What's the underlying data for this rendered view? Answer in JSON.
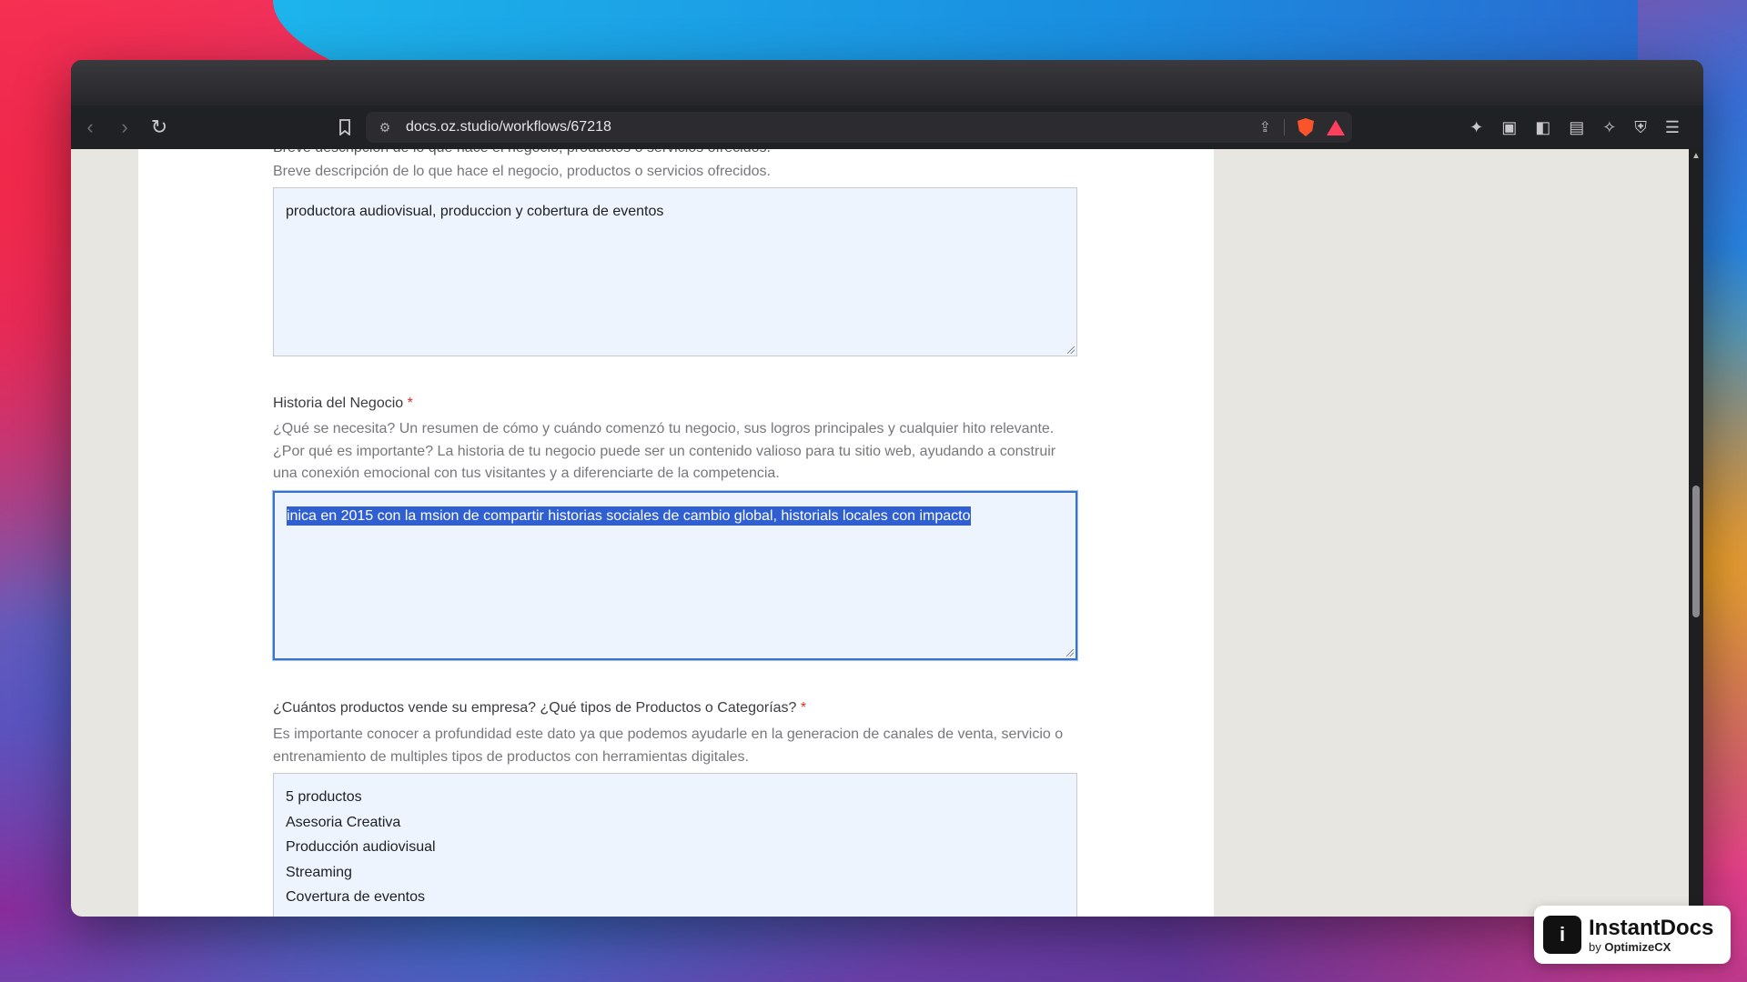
{
  "browser": {
    "url": "docs.oz.studio/workflows/67218"
  },
  "form": {
    "cut_off_label": "Breve descripción de lo que hace el negocio, productos o servicios ofrecidos.",
    "business_description": {
      "help": "Breve descripción de lo que hace el negocio, productos o servicios ofrecidos.",
      "value": "productora audiovisual, produccion y cobertura de eventos"
    },
    "business_history": {
      "label": "Historia del Negocio",
      "required_mark": "*",
      "help": "¿Qué se necesita? Un resumen de cómo y cuándo comenzó tu negocio, sus logros principales y cualquier hito relevante. ¿Por qué es importante? La historia de tu negocio puede ser un contenido valioso para tu sitio web, ayudando a construir una conexión emocional con tus visitantes y a diferenciarte de la competencia.",
      "value": "inica en 2015 con la msion de compartir historias sociales de cambio global, historials locales con impacto"
    },
    "products": {
      "label": "¿Cuántos productos vende su empresa? ¿Qué tipos de Productos o Categorías?",
      "required_mark": "*",
      "help": "Es importante conocer a profundidad este dato ya que podemos ayudarle en la generacion de canales de venta, servicio o entrenamiento de multiples tipos de productos con herramientas digitales.",
      "lines": [
        "5 productos",
        "Asesoria Creativa",
        "Producción audiovisual",
        "Streaming",
        "Covertura de eventos"
      ]
    }
  },
  "watermark": {
    "name": "InstantDocs",
    "by": "by",
    "company": "OptimizeCX"
  },
  "colors": {
    "selection": "#2f5fd0",
    "focus_border": "#3b73c8",
    "textarea_bg": "#eef4fd",
    "required": "#d93025"
  }
}
